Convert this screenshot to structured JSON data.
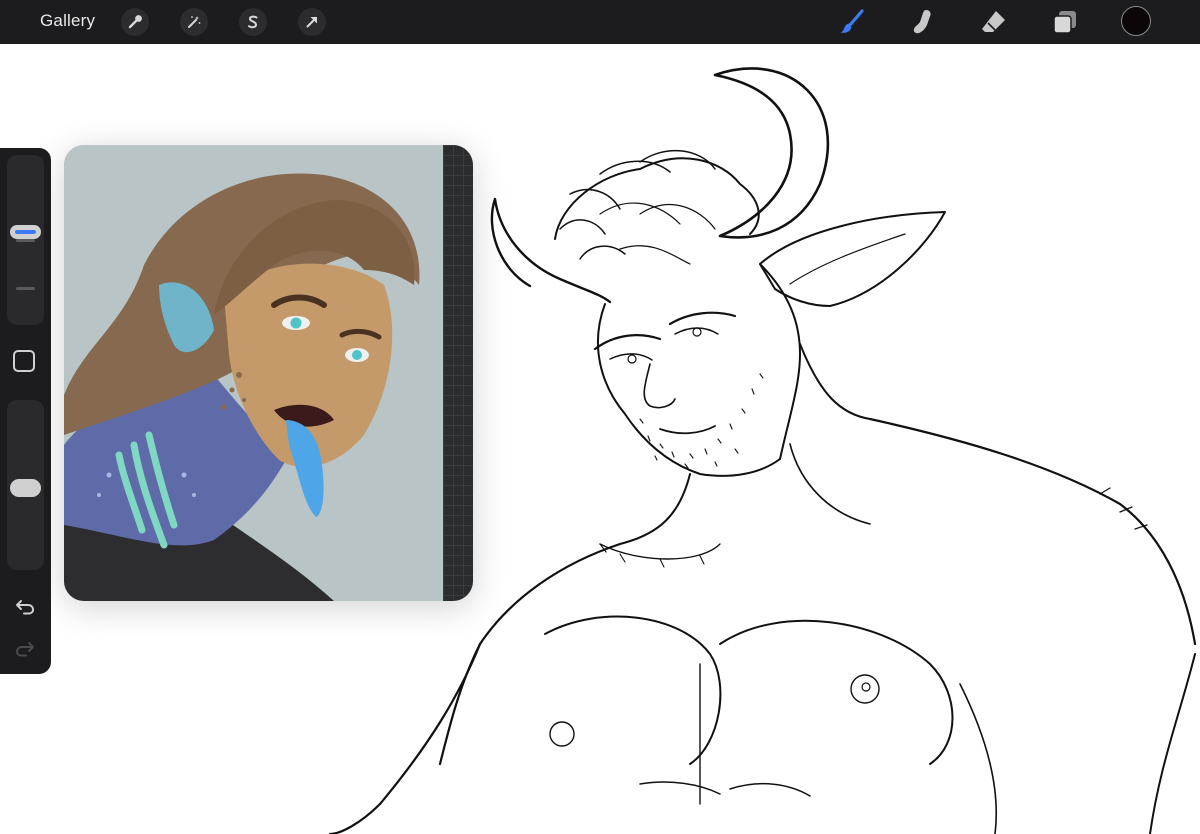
{
  "app": {
    "gallery_label": "Gallery"
  },
  "toolbar": {
    "left_tools": [
      {
        "name": "actions",
        "icon": "wrench-icon"
      },
      {
        "name": "adjustments",
        "icon": "magic-wand-icon"
      },
      {
        "name": "selection",
        "icon": "selection-s-icon"
      },
      {
        "name": "transform",
        "icon": "arrow-cursor-icon"
      }
    ],
    "right_tools": [
      {
        "name": "brush",
        "icon": "brush-icon",
        "active": true
      },
      {
        "name": "smudge",
        "icon": "smudge-finger-icon",
        "active": false
      },
      {
        "name": "eraser",
        "icon": "eraser-icon",
        "active": false
      },
      {
        "name": "layers",
        "icon": "layers-icon",
        "active": false
      }
    ],
    "current_color": "#0d0608",
    "accent_color": "#3b7cf4"
  },
  "sidebar": {
    "brush_size_level": 0.55,
    "brush_opacity_level": 0.48,
    "modify_icon": "square-modify-icon",
    "undo_icon": "undo-icon",
    "redo_icon": "redo-icon"
  },
  "reference": {
    "background_color": "#b8c4c5"
  }
}
